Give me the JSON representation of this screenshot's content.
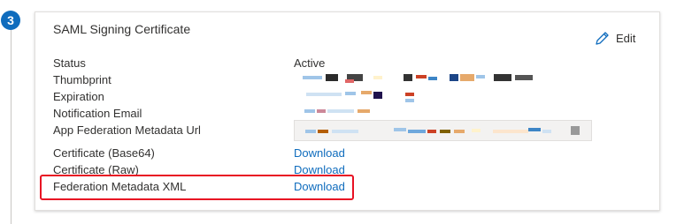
{
  "step": {
    "number": "3"
  },
  "card": {
    "title": "SAML Signing Certificate",
    "edit_label": "Edit",
    "edit_icon": "pencil-icon",
    "fields": {
      "status": {
        "label": "Status",
        "value": "Active"
      },
      "thumbprint": {
        "label": "Thumbprint"
      },
      "expiration": {
        "label": "Expiration"
      },
      "notification_email": {
        "label": "Notification Email"
      },
      "metadata_url": {
        "label": "App Federation Metadata Url"
      },
      "cert_base64": {
        "label": "Certificate (Base64)",
        "link": "Download"
      },
      "cert_raw": {
        "label": "Certificate (Raw)",
        "link": "Download"
      },
      "federation_xml": {
        "label": "Federation Metadata XML",
        "link": "Download"
      }
    }
  },
  "colors": {
    "link": "#0f6cbd",
    "badge": "#0f6cbd",
    "highlight": "#e81123"
  }
}
